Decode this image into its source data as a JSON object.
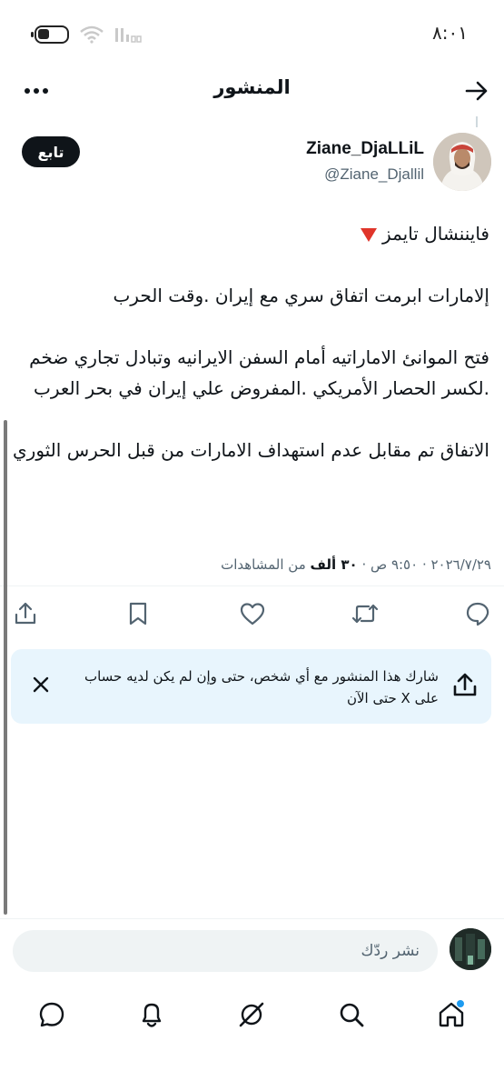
{
  "status_bar": {
    "time": "٨:٠١",
    "icons": [
      "battery-icon",
      "wifi-icon",
      "signal-icon"
    ]
  },
  "header": {
    "title": "المنشور",
    "back_icon": "arrow-icon",
    "more_icon": "more-dots-icon"
  },
  "author": {
    "name": "Ziane_DjaLLiL",
    "handle": "@Ziane_Djallil",
    "follow_label": "تابع"
  },
  "post": {
    "source": "فايننشال تايمز",
    "line1": "إلامارات ابرمت اتفاق سري  مع إيران .وقت الحرب",
    "line2": "فتح الموانئ الاماراتيه أمام السفن الايرانيه  وتبادل تجاري ضخم .لكسر الحصار الأمريكي .المفروض علي إيران في بحر العرب",
    "line3": "الاتفاق تم مقابل عدم استهداف الامارات من قبل الحرس الثوري"
  },
  "meta": {
    "datetime": "٢٠٢٦/٧/٢٩ · ٩:٥٠ ص · ",
    "views_count": "٣٠ ألف",
    "views_label": " من المشاهدات"
  },
  "actions": [
    "reply-icon",
    "repost-icon",
    "like-icon",
    "bookmark-icon",
    "share-icon"
  ],
  "share_card": {
    "text": "شارك هذا المنشور مع أي شخص، حتى وإن لم يكن لديه حساب على X حتى الآن"
  },
  "reply": {
    "placeholder": "نشر ردّك"
  },
  "nav": [
    "home-icon",
    "search-icon",
    "grok-icon",
    "notifications-icon",
    "messages-icon"
  ],
  "colors": {
    "accent": "#1d9bf0",
    "text": "#0f1419",
    "secondary": "#536471",
    "share_bg": "#e8f5fd",
    "alert_red": "#e0352a"
  }
}
